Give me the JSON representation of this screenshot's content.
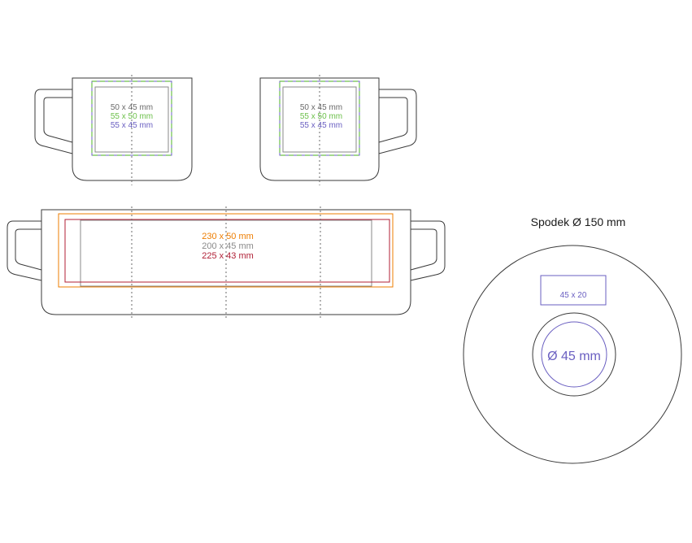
{
  "colors": {
    "outline": "#3a3a3a",
    "orange": "#ee7d00",
    "gray": "#8a8a8a",
    "green": "#6cc04a",
    "blue": "#6a5fc1",
    "darkred": "#b01f35",
    "label_gray": "#6a6a6a"
  },
  "mug_left": {
    "label_1": "50 x 45 mm",
    "label_2": "55 x 50 mm",
    "label_3": "55 x 45 mm"
  },
  "mug_right": {
    "label_1": "50 x 45 mm",
    "label_2": "55 x 50 mm",
    "label_3": "55 x 45 mm"
  },
  "mug_wrap": {
    "label_1": "230 x 50 mm",
    "label_2": "200 x 45 mm",
    "label_3": "225 x 43 mm"
  },
  "saucer": {
    "title": "Spodek Ø 150 mm",
    "rect_label": "45 x 20",
    "circle_label": "Ø 45 mm"
  }
}
